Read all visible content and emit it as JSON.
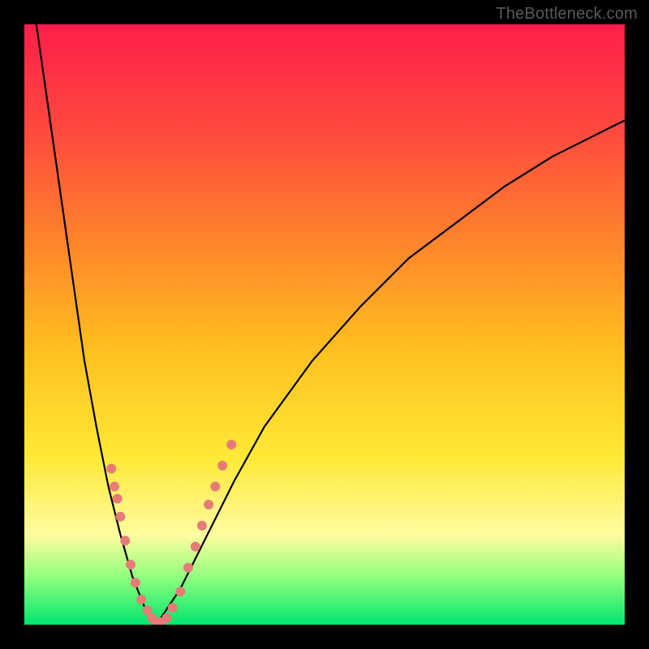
{
  "watermark": "TheBottleneck.com",
  "chart_data": {
    "type": "line",
    "title": "",
    "xlabel": "",
    "ylabel": "",
    "xlim": [
      0,
      100
    ],
    "ylim": [
      0,
      100
    ],
    "grid": false,
    "legend": false,
    "note": "Bottleneck mismatch curve. Minimum at x≈22 (0% bottleneck). Two asymptotic branches toward 100% at left edge (x→0) and right edge (x→100). Red dots highlight near-optimum sample points on both branches.",
    "curve": {
      "optimum_x": 22,
      "left_branch_x": [
        2,
        4,
        6,
        8,
        10,
        12,
        14,
        16,
        18,
        20,
        22
      ],
      "left_branch_y": [
        100,
        86,
        72,
        58,
        44,
        33,
        23,
        15,
        8,
        3,
        0
      ],
      "right_branch_x": [
        22,
        26,
        30,
        35,
        40,
        48,
        56,
        64,
        72,
        80,
        88,
        96,
        100
      ],
      "right_branch_y": [
        0,
        6,
        14,
        24,
        33,
        44,
        53,
        61,
        67,
        73,
        78,
        82,
        84
      ]
    },
    "highlight_points": {
      "color": "#e77b78",
      "radius": 6,
      "points": [
        {
          "x": 14.5,
          "y": 26
        },
        {
          "x": 15.0,
          "y": 23
        },
        {
          "x": 15.5,
          "y": 21
        },
        {
          "x": 16.0,
          "y": 18
        },
        {
          "x": 16.8,
          "y": 14
        },
        {
          "x": 17.7,
          "y": 10
        },
        {
          "x": 18.5,
          "y": 7
        },
        {
          "x": 19.5,
          "y": 4.2
        },
        {
          "x": 20.5,
          "y": 2.4
        },
        {
          "x": 21.3,
          "y": 1.1
        },
        {
          "x": 22.0,
          "y": 0.4
        },
        {
          "x": 22.8,
          "y": 0.4
        },
        {
          "x": 23.7,
          "y": 1.1
        },
        {
          "x": 24.7,
          "y": 2.8
        },
        {
          "x": 26.0,
          "y": 5.5
        },
        {
          "x": 27.3,
          "y": 9.5
        },
        {
          "x": 28.5,
          "y": 13.0
        },
        {
          "x": 29.6,
          "y": 16.5
        },
        {
          "x": 30.7,
          "y": 20.0
        },
        {
          "x": 31.8,
          "y": 23.0
        },
        {
          "x": 33.0,
          "y": 26.5
        },
        {
          "x": 34.5,
          "y": 30.0
        }
      ]
    }
  }
}
